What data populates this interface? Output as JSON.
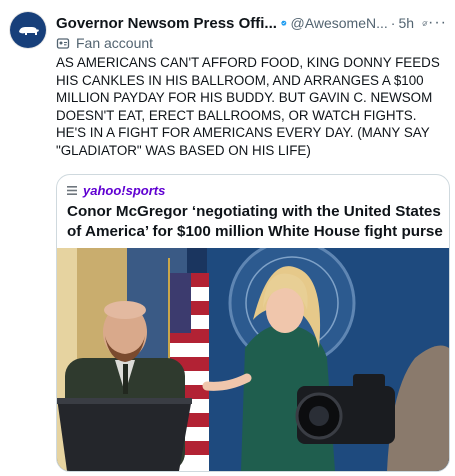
{
  "post": {
    "author_name": "Governor Newsom Press Offi...",
    "handle": "@AwesomeN...",
    "separator": "·",
    "time": "5h",
    "more": "···",
    "label": "Fan account",
    "text": "AS AMERICANS CAN'T AFFORD FOOD, KING DONNY FEEDS HIS CANKLES IN HIS BALLROOM, AND ARRANGES A $100 MILLION PAYDAY FOR HIS BUDDY. BUT GAVIN C. NEWSOM DOESN'T EAT, ERECT BALLROOMS, OR WATCH FIGHTS. HE'S IN A FIGHT FOR AMERICANS EVERY DAY. (MANY SAY \"GLADIATOR\" WAS BASED ON HIS LIFE)"
  },
  "card": {
    "source_name": "yahoo!sports",
    "headline": "Conor McGregor ‘negotiating with the United States of America’ for $100 million White House fight purse"
  },
  "icons": {
    "verified": "verified-badge-icon",
    "grok": "grok-icon",
    "fan": "fan-account-icon",
    "menu": "menu-icon"
  },
  "colors": {
    "verified_blue": "#1d9bf0",
    "yahoo_purple": "#6001d2",
    "avatar_bg": "#173f7a"
  }
}
